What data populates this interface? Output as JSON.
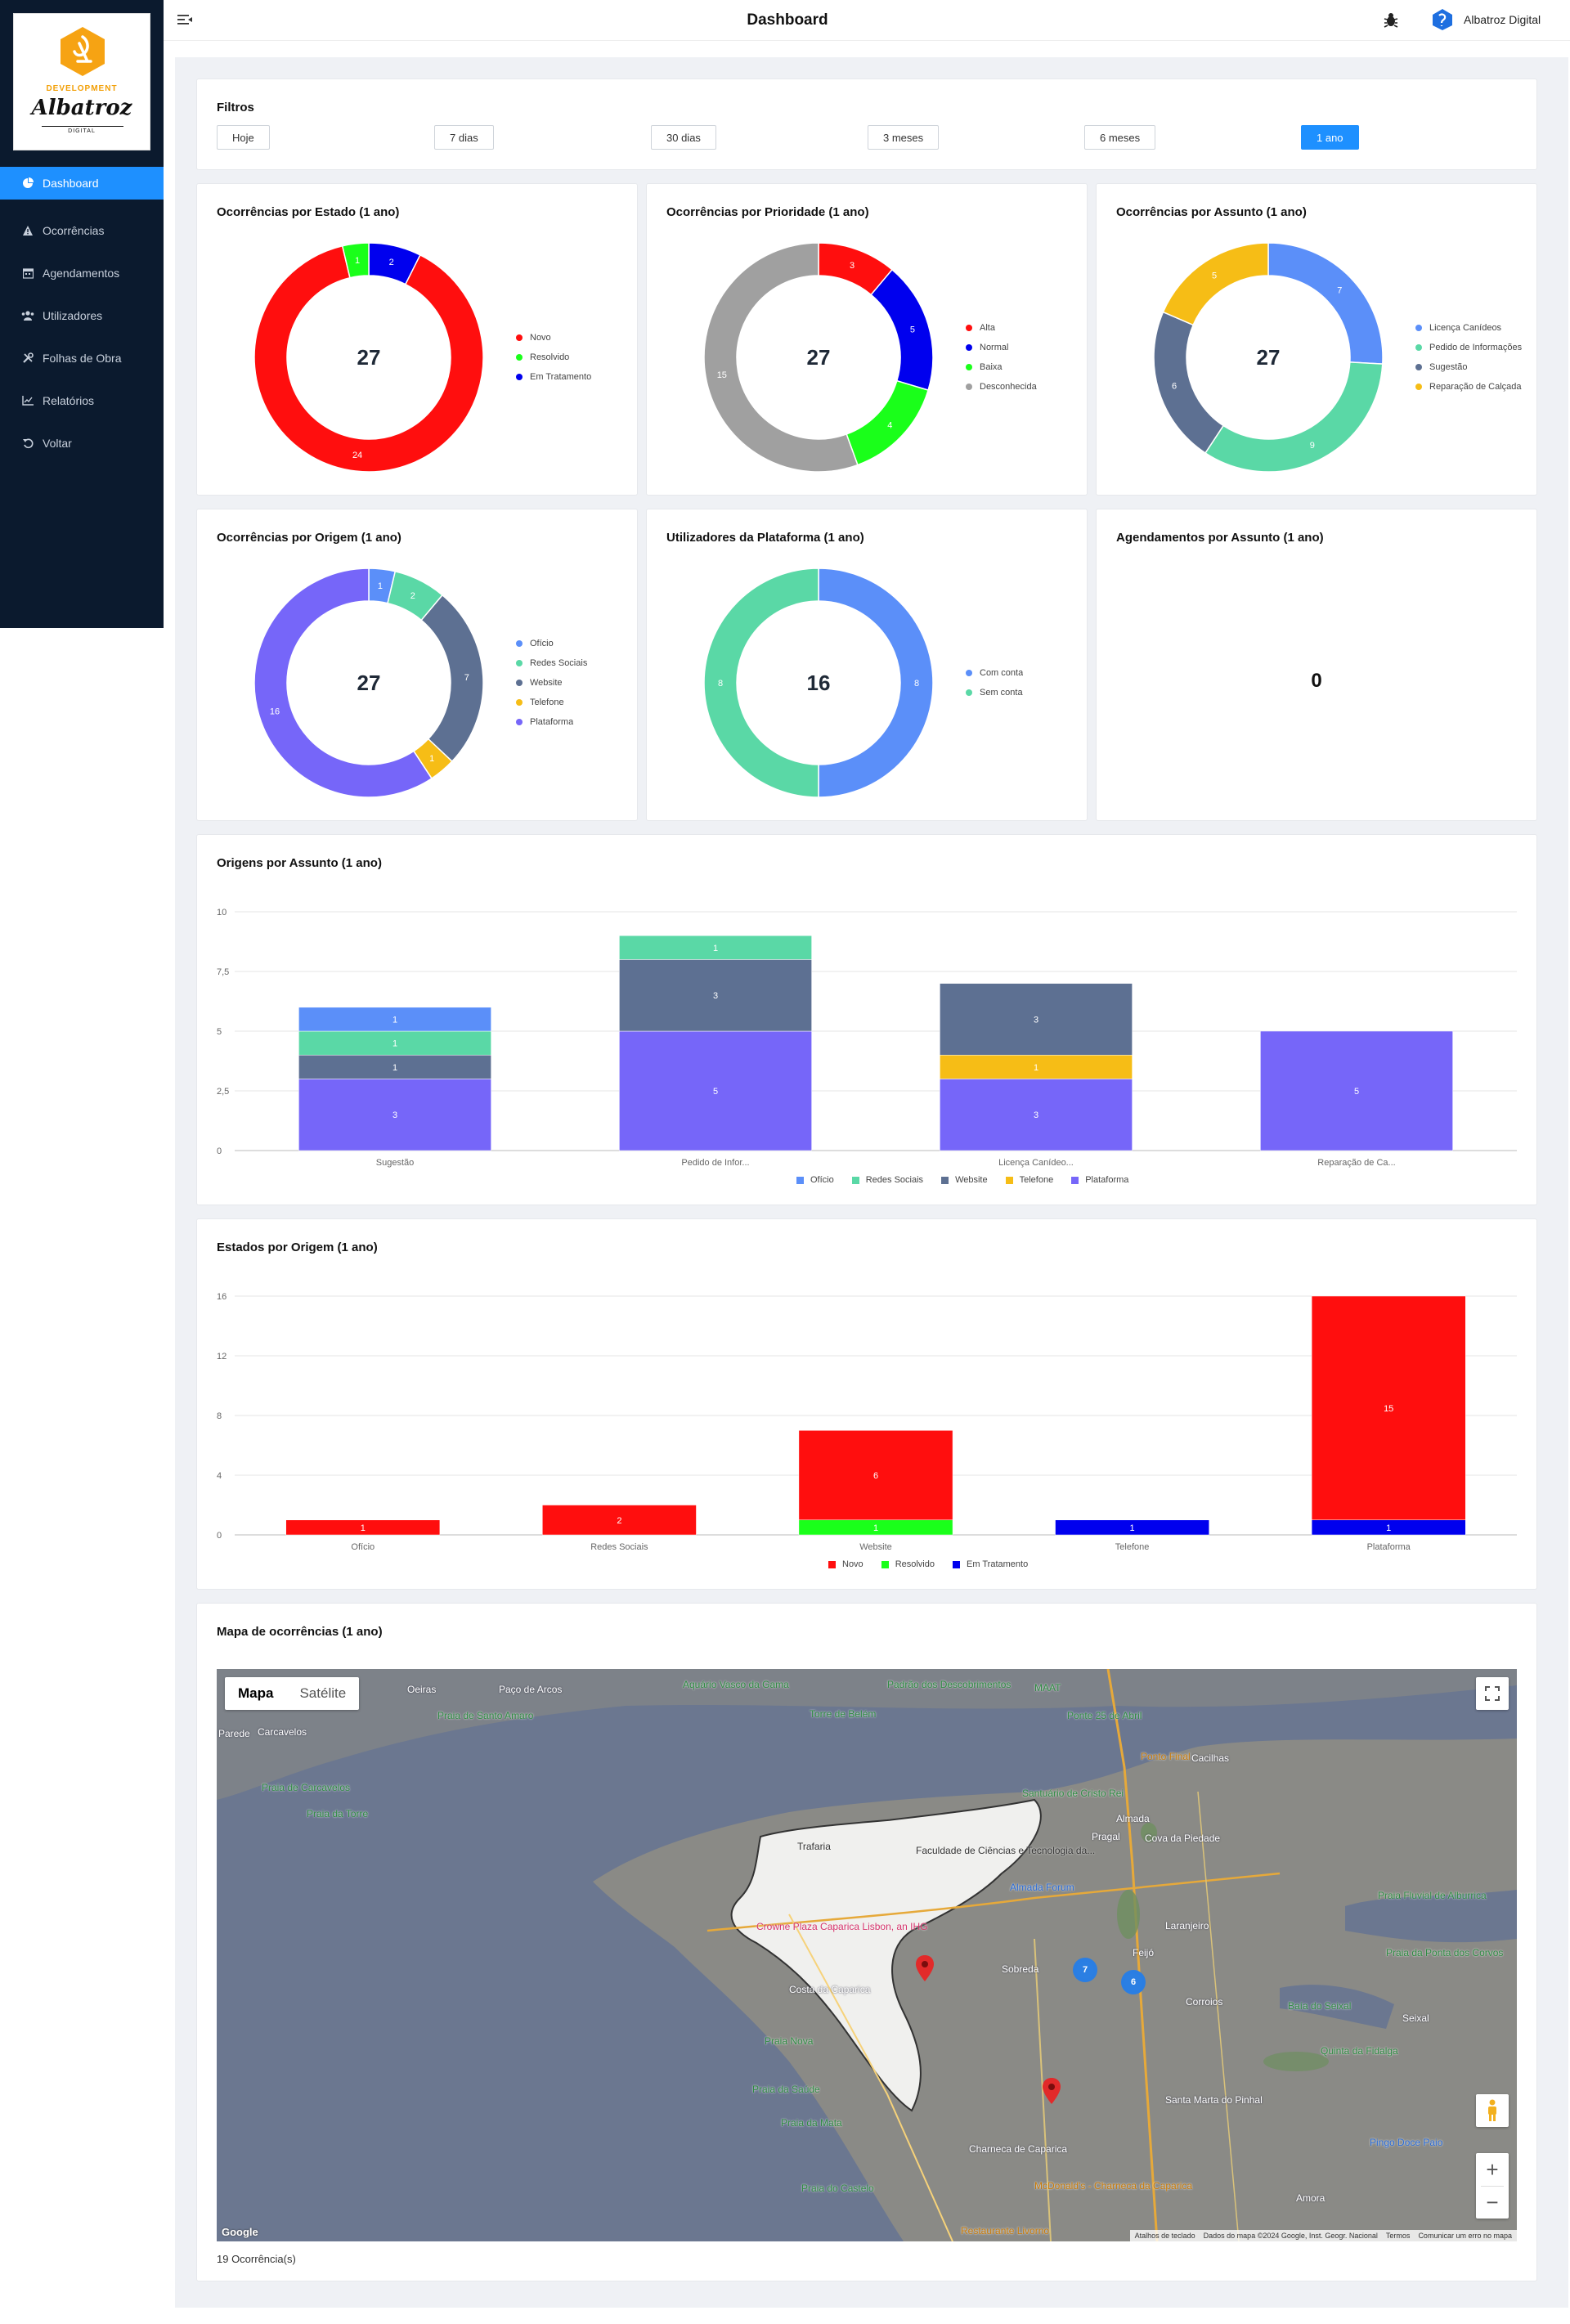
{
  "app": {
    "logo_dev": "DEVELOPMENT",
    "logo_name": "Albatroz",
    "logo_sub": "DIGITAL",
    "page_title": "Dashboard",
    "user_name": "Albatroz Digital"
  },
  "sidebar": {
    "items": [
      {
        "label": "Dashboard",
        "icon": "pie-chart-icon",
        "active": true
      },
      {
        "label": "Ocorrências",
        "icon": "warning-icon"
      },
      {
        "label": "Agendamentos",
        "icon": "calendar-icon"
      },
      {
        "label": "Utilizadores",
        "icon": "users-icon"
      },
      {
        "label": "Folhas de Obra",
        "icon": "tools-icon"
      },
      {
        "label": "Relatórios",
        "icon": "chart-icon"
      },
      {
        "label": "Voltar",
        "icon": "undo-icon"
      }
    ]
  },
  "filters": {
    "title": "Filtros",
    "buttons": [
      "Hoje",
      "7 dias",
      "30 dias",
      "3 meses",
      "6 meses",
      "1 ano"
    ],
    "selected": "1 ano"
  },
  "colors": {
    "red": "#ff0e0e",
    "green": "#1aff1a",
    "blue": "#0000ee",
    "gray": "#a0a0a0",
    "sky": "#5b8ff9",
    "mint": "#5ad8a6",
    "slate": "#5d7092",
    "yellow": "#f6bd16",
    "violet": "#7666f9"
  },
  "donuts": [
    {
      "title": "Ocorrências por Estado (1 ano)",
      "total": "27",
      "slices": [
        {
          "label": "Novo",
          "value": 24,
          "color": "#ff0e0e"
        },
        {
          "label": "Resolvido",
          "value": 1,
          "color": "#1aff1a"
        },
        {
          "label": "Em Tratamento",
          "value": 2,
          "color": "#0000ee"
        }
      ],
      "order": [
        2,
        0,
        1
      ]
    },
    {
      "title": "Ocorrências por Prioridade (1 ano)",
      "total": "27",
      "slices": [
        {
          "label": "Alta",
          "value": 3,
          "color": "#ff0e0e"
        },
        {
          "label": "Normal",
          "value": 5,
          "color": "#0000ee"
        },
        {
          "label": "Baixa",
          "value": 4,
          "color": "#1aff1a"
        },
        {
          "label": "Desconhecida",
          "value": 15,
          "color": "#a0a0a0"
        }
      ],
      "order": [
        0,
        1,
        2,
        3
      ]
    },
    {
      "title": "Ocorrências por Assunto (1 ano)",
      "total": "27",
      "slices": [
        {
          "label": "Licença Canídeos",
          "value": 7,
          "color": "#5b8ff9"
        },
        {
          "label": "Pedido de Informações",
          "value": 9,
          "color": "#5ad8a6"
        },
        {
          "label": "Sugestão",
          "value": 6,
          "color": "#5d7092"
        },
        {
          "label": "Reparação de Calçada",
          "value": 5,
          "color": "#f6bd16"
        }
      ],
      "order": [
        0,
        1,
        2,
        3
      ]
    },
    {
      "title": "Ocorrências por Origem (1 ano)",
      "total": "27",
      "slices": [
        {
          "label": "Ofício",
          "value": 1,
          "color": "#5b8ff9"
        },
        {
          "label": "Redes Sociais",
          "value": 2,
          "color": "#5ad8a6"
        },
        {
          "label": "Website",
          "value": 7,
          "color": "#5d7092"
        },
        {
          "label": "Telefone",
          "value": 1,
          "color": "#f6bd16"
        },
        {
          "label": "Plataforma",
          "value": 16,
          "color": "#7666f9"
        }
      ],
      "order": [
        0,
        1,
        2,
        3,
        4
      ]
    },
    {
      "title": "Utilizadores da Plataforma (1 ano)",
      "total": "16",
      "slices": [
        {
          "label": "Com conta",
          "value": 8,
          "color": "#5b8ff9"
        },
        {
          "label": "Sem conta",
          "value": 8,
          "color": "#5ad8a6"
        }
      ],
      "order": [
        0,
        1
      ]
    }
  ],
  "agendamentos": {
    "title": "Agendamentos por Assunto (1 ano)",
    "total": "0"
  },
  "chart_data": [
    {
      "type": "bar",
      "title": "Origens por Assunto (1 ano)",
      "categories": [
        "Sugestão",
        "Pedido de Infor...",
        "Licença Canídeo...",
        "Reparação de Ca..."
      ],
      "ylim": [
        0,
        10
      ],
      "yticks": [
        "0",
        "2,5",
        "5",
        "7,5",
        "10"
      ],
      "stacked": true,
      "series": [
        {
          "name": "Plataforma",
          "color": "#7666f9",
          "values": [
            3,
            5,
            3,
            5
          ]
        },
        {
          "name": "Telefone",
          "color": "#f6bd16",
          "values": [
            0,
            0,
            1,
            0
          ]
        },
        {
          "name": "Website",
          "color": "#5d7092",
          "values": [
            1,
            3,
            3,
            0
          ]
        },
        {
          "name": "Redes Sociais",
          "color": "#5ad8a6",
          "values": [
            1,
            1,
            0,
            0
          ]
        },
        {
          "name": "Ofício",
          "color": "#5b8ff9",
          "values": [
            1,
            0,
            0,
            0
          ]
        }
      ],
      "legend": [
        "Ofício",
        "Redes Sociais",
        "Website",
        "Telefone",
        "Plataforma"
      ],
      "legend_placement": "bottom",
      "grid": true
    },
    {
      "type": "bar",
      "title": "Estados por Origem (1 ano)",
      "categories": [
        "Ofício",
        "Redes Sociais",
        "Website",
        "Telefone",
        "Plataforma"
      ],
      "ylim": [
        0,
        16
      ],
      "yticks": [
        "0",
        "4",
        "8",
        "12",
        "16"
      ],
      "stacked": true,
      "series": [
        {
          "name": "Em Tratamento",
          "color": "#0000ee",
          "values": [
            0,
            0,
            0,
            1,
            1
          ]
        },
        {
          "name": "Resolvido",
          "color": "#1aff1a",
          "values": [
            0,
            0,
            1,
            0,
            0
          ]
        },
        {
          "name": "Novo",
          "color": "#ff0e0e",
          "values": [
            1,
            2,
            6,
            0,
            15
          ]
        }
      ],
      "legend": [
        "Novo",
        "Resolvido",
        "Em Tratamento"
      ],
      "legend_placement": "bottom",
      "grid": true
    }
  ],
  "map": {
    "title": "Mapa de ocorrências (1 ano)",
    "tab_map": "Mapa",
    "tab_satellite": "Satélite",
    "clusters": [
      "7",
      "6"
    ],
    "attribution": [
      "Atalhos de teclado",
      "Dados do mapa ©2024 Google, Inst. Geogr. Nacional",
      "Termos",
      "Comunicar um erro no mapa"
    ],
    "google": "Google",
    "count": "19 Ocorrência(s)",
    "labels": [
      {
        "text": "Oeiras",
        "cls": "",
        "l": 233,
        "t": 18
      },
      {
        "text": "Paço de Arcos",
        "cls": "",
        "l": 345,
        "t": 18
      },
      {
        "text": "Carcavelos",
        "cls": "",
        "l": 50,
        "t": 70
      },
      {
        "text": "Parede",
        "cls": "",
        "l": 2,
        "t": 72
      },
      {
        "text": "Praia de Carcavelos",
        "cls": "green",
        "l": 55,
        "t": 138
      },
      {
        "text": "Praia da Torre",
        "cls": "green",
        "l": 110,
        "t": 170
      },
      {
        "text": "Praia de Santo Amaro",
        "cls": "green",
        "l": 270,
        "t": 50
      },
      {
        "text": "Aquário Vasco da Gama",
        "cls": "green",
        "l": 570,
        "t": 12
      },
      {
        "text": "Padrão dos Descobrimentos",
        "cls": "green",
        "l": 820,
        "t": 12
      },
      {
        "text": "MAAT",
        "cls": "green",
        "l": 1000,
        "t": 16
      },
      {
        "text": "Torre de Belém",
        "cls": "green",
        "l": 725,
        "t": 48
      },
      {
        "text": "Ponte 25 de Abril",
        "cls": "green",
        "l": 1040,
        "t": 50
      },
      {
        "text": "Santuário de Cristo Rei",
        "cls": "green",
        "l": 985,
        "t": 145
      },
      {
        "text": "Ponto Final",
        "cls": "orange",
        "l": 1130,
        "t": 100
      },
      {
        "text": "Cacilhas",
        "cls": "",
        "l": 1192,
        "t": 102
      },
      {
        "text": "Almada",
        "cls": "",
        "l": 1100,
        "t": 176
      },
      {
        "text": "Pragal",
        "cls": "",
        "l": 1070,
        "t": 198
      },
      {
        "text": "Cova da Piedade",
        "cls": "",
        "l": 1135,
        "t": 200
      },
      {
        "text": "Trafaria",
        "cls": "dark",
        "l": 710,
        "t": 210
      },
      {
        "text": "Faculdade de Ciências e Tecnologia da...",
        "cls": "dark",
        "l": 855,
        "t": 215
      },
      {
        "text": "Almada Forum",
        "cls": "blue",
        "l": 970,
        "t": 260
      },
      {
        "text": "Crowne Plaza Caparica Lisbon, an IHG",
        "cls": "red",
        "l": 660,
        "t": 308
      },
      {
        "text": "Sobreda",
        "cls": "",
        "l": 960,
        "t": 360
      },
      {
        "text": "Costa da Caparica",
        "cls": "",
        "l": 700,
        "t": 385
      },
      {
        "text": "Feijó",
        "cls": "",
        "l": 1120,
        "t": 340
      },
      {
        "text": "Laranjeiro",
        "cls": "",
        "l": 1160,
        "t": 307
      },
      {
        "text": "Corroios",
        "cls": "",
        "l": 1185,
        "t": 400
      },
      {
        "text": "Praia Nova",
        "cls": "green",
        "l": 670,
        "t": 448
      },
      {
        "text": "Praia da Saúde",
        "cls": "green",
        "l": 655,
        "t": 507
      },
      {
        "text": "Praia da Mata",
        "cls": "green",
        "l": 690,
        "t": 548
      },
      {
        "text": "Praia do Castelo",
        "cls": "green",
        "l": 715,
        "t": 628
      },
      {
        "text": "Charneca de Caparica",
        "cls": "",
        "l": 920,
        "t": 580
      },
      {
        "text": "Santa Marta do Pinhal",
        "cls": "",
        "l": 1160,
        "t": 520
      },
      {
        "text": "McDonald's - Charneca da Caparica",
        "cls": "orange",
        "l": 1000,
        "t": 625
      },
      {
        "text": "Restaurante Livorno",
        "cls": "orange",
        "l": 910,
        "t": 680
      },
      {
        "text": "Quinta da Fidalga",
        "cls": "green",
        "l": 1350,
        "t": 460
      },
      {
        "text": "Praia da Ponta dos Corvos",
        "cls": "green",
        "l": 1430,
        "t": 340
      },
      {
        "text": "Praia Fluvial de Alburrica",
        "cls": "green",
        "l": 1420,
        "t": 270
      },
      {
        "text": "Seixal",
        "cls": "",
        "l": 1450,
        "t": 420
      },
      {
        "text": "Amora",
        "cls": "",
        "l": 1320,
        "t": 640
      },
      {
        "text": "Pingo Doce Paio",
        "cls": "blue",
        "l": 1410,
        "t": 572
      },
      {
        "text": "Baía do Seixal",
        "cls": "green",
        "l": 1310,
        "t": 405
      }
    ]
  }
}
